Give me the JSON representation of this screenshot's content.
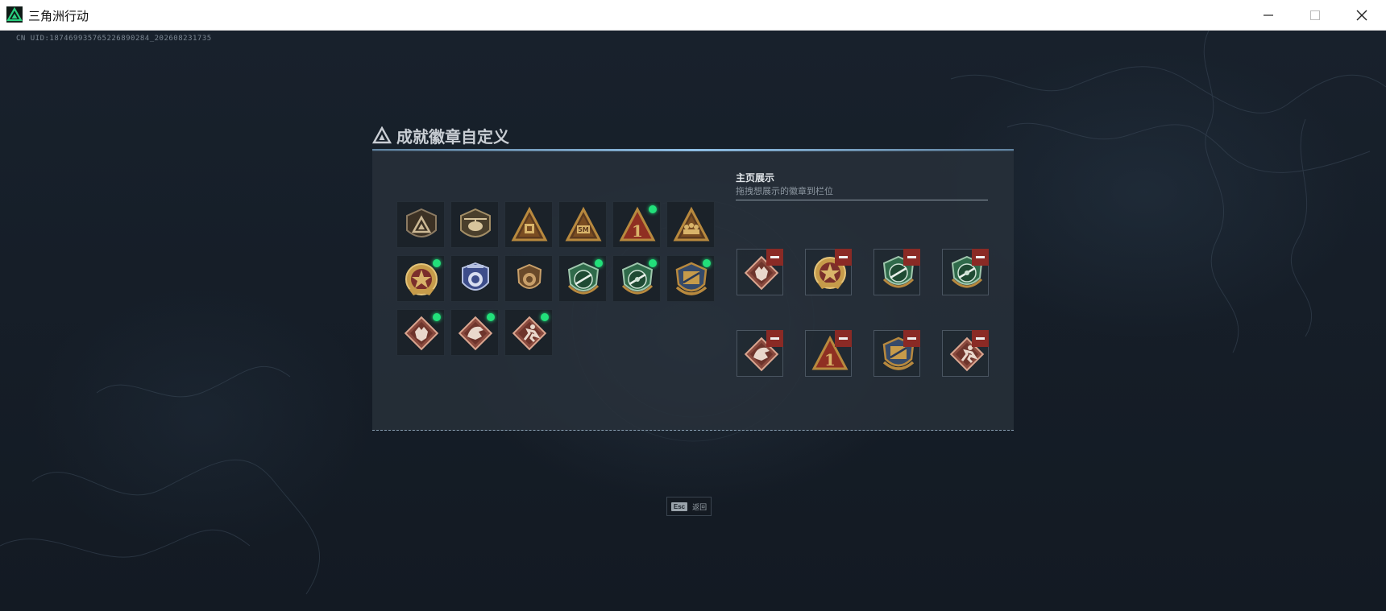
{
  "window": {
    "title": "三角洲行动",
    "minimize_icon": "minimize-icon",
    "maximize_icon": "maximize-icon",
    "close_icon": "close-icon"
  },
  "game": {
    "uid_text": "CN UID:187469935765226890284_202608231735"
  },
  "panel": {
    "title": "成就徽章自定义",
    "title_icon": "delta-triangle-icon"
  },
  "badge_grid": [
    {
      "name": "badge-delta-shield",
      "new": false
    },
    {
      "name": "badge-helicopter",
      "new": false
    },
    {
      "name": "badge-gold-triangle-vault",
      "new": false
    },
    {
      "name": "badge-gold-triangle-5m",
      "new": false
    },
    {
      "name": "badge-triangle-number-one",
      "new": true
    },
    {
      "name": "badge-gold-triangle-squad",
      "new": false
    },
    {
      "name": "badge-star-medal",
      "new": true
    },
    {
      "name": "badge-police-shield",
      "new": false
    },
    {
      "name": "badge-lion-crest",
      "new": false
    },
    {
      "name": "badge-green-rifle-laurel-a",
      "new": true
    },
    {
      "name": "badge-green-rifle-laurel-b",
      "new": true
    },
    {
      "name": "badge-rifle-crest-gold",
      "new": true
    },
    {
      "name": "badge-wolf-diamond",
      "new": true
    },
    {
      "name": "badge-dragon-diamond",
      "new": true
    },
    {
      "name": "badge-runner-diamond",
      "new": true
    }
  ],
  "showcase": {
    "title": "主页展示",
    "subtitle": "拖拽想展示的徽章到栏位",
    "slots": [
      {
        "name": "showcase-wolf-diamond"
      },
      {
        "name": "showcase-star-medal"
      },
      {
        "name": "showcase-green-rifle-laurel-a"
      },
      {
        "name": "showcase-green-rifle-laurel-b"
      },
      {
        "name": "showcase-dragon-diamond"
      },
      {
        "name": "showcase-triangle-number-one"
      },
      {
        "name": "showcase-rifle-crest-gold"
      },
      {
        "name": "showcase-runner-diamond"
      }
    ]
  },
  "footer": {
    "esc_key": "Esc",
    "esc_label": "返回"
  },
  "colors": {
    "new_dot": "#22e07a",
    "remove_button": "#8a2a25",
    "gold": "#b8893e",
    "green_badge": "#2e6b4a",
    "diamond_badge": "#7a3e36"
  }
}
